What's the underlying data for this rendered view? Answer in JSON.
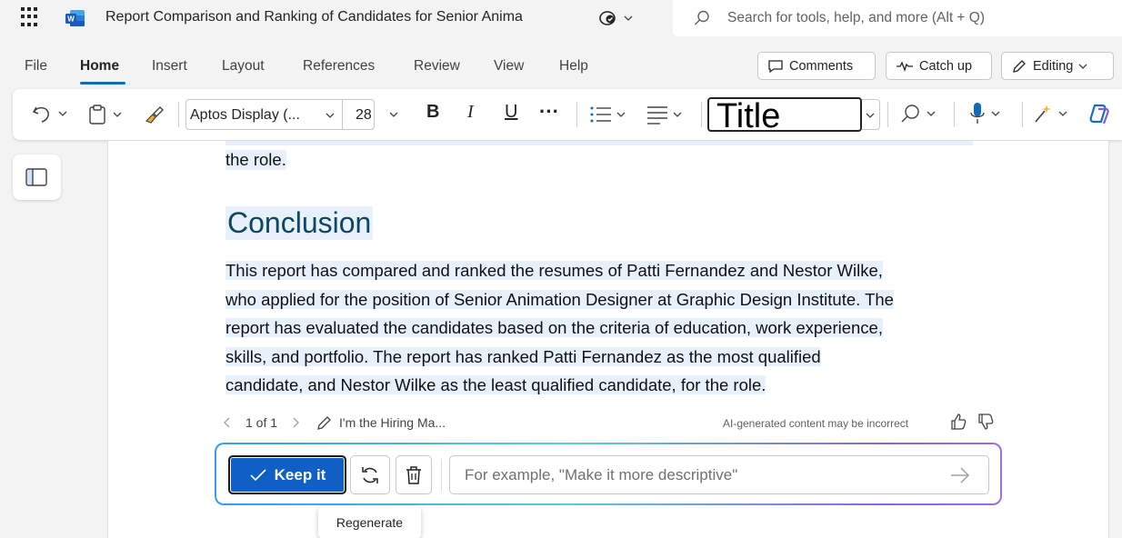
{
  "titlebar": {
    "app_icon": "word-icon",
    "doc_title": "Report Comparison and Ranking of Candidates for Senior Anima",
    "search_placeholder": "Search for tools, help, and more (Alt + Q)"
  },
  "ribbon": {
    "tabs": [
      "File",
      "Home",
      "Insert",
      "Layout",
      "References",
      "Review",
      "View",
      "Help"
    ],
    "active_tab": "Home",
    "comments_label": "Comments",
    "catchup_label": "Catch up",
    "editing_label": "Editing"
  },
  "toolbar": {
    "font_name": "Aptos Display (...",
    "font_size": "28",
    "bold": "B",
    "italic": "I",
    "underline": "U",
    "more": "···",
    "style_name": "Title"
  },
  "document": {
    "prev_text": "the role.",
    "heading": "Conclusion",
    "paragraph_lines": [
      "This report has compared and ranked the resumes of Patti Fernandez and Nestor Wilke,",
      "who applied for the position of Senior Animation Designer at Graphic Design Institute. The",
      "report has evaluated the candidates based on the criteria of education, work experience,",
      "skills, and portfolio. The report has ranked Patti Fernandez as the most qualified",
      "candidate, and Nestor Wilke as the least qualified candidate, for the role."
    ]
  },
  "ai": {
    "page_indicator": "1 of 1",
    "prompt_summary": "I'm the Hiring Ma...",
    "disclaimer": "AI-generated content may be incorrect",
    "keep_label": "Keep it",
    "prompt_placeholder": "For example, \"Make it more descriptive\"",
    "tooltip": "Regenerate"
  },
  "colors": {
    "accent": "#0f6cbd",
    "keep_button": "#0f5fc4",
    "heading": "#0e4761",
    "highlight": "#e8f1fb"
  }
}
